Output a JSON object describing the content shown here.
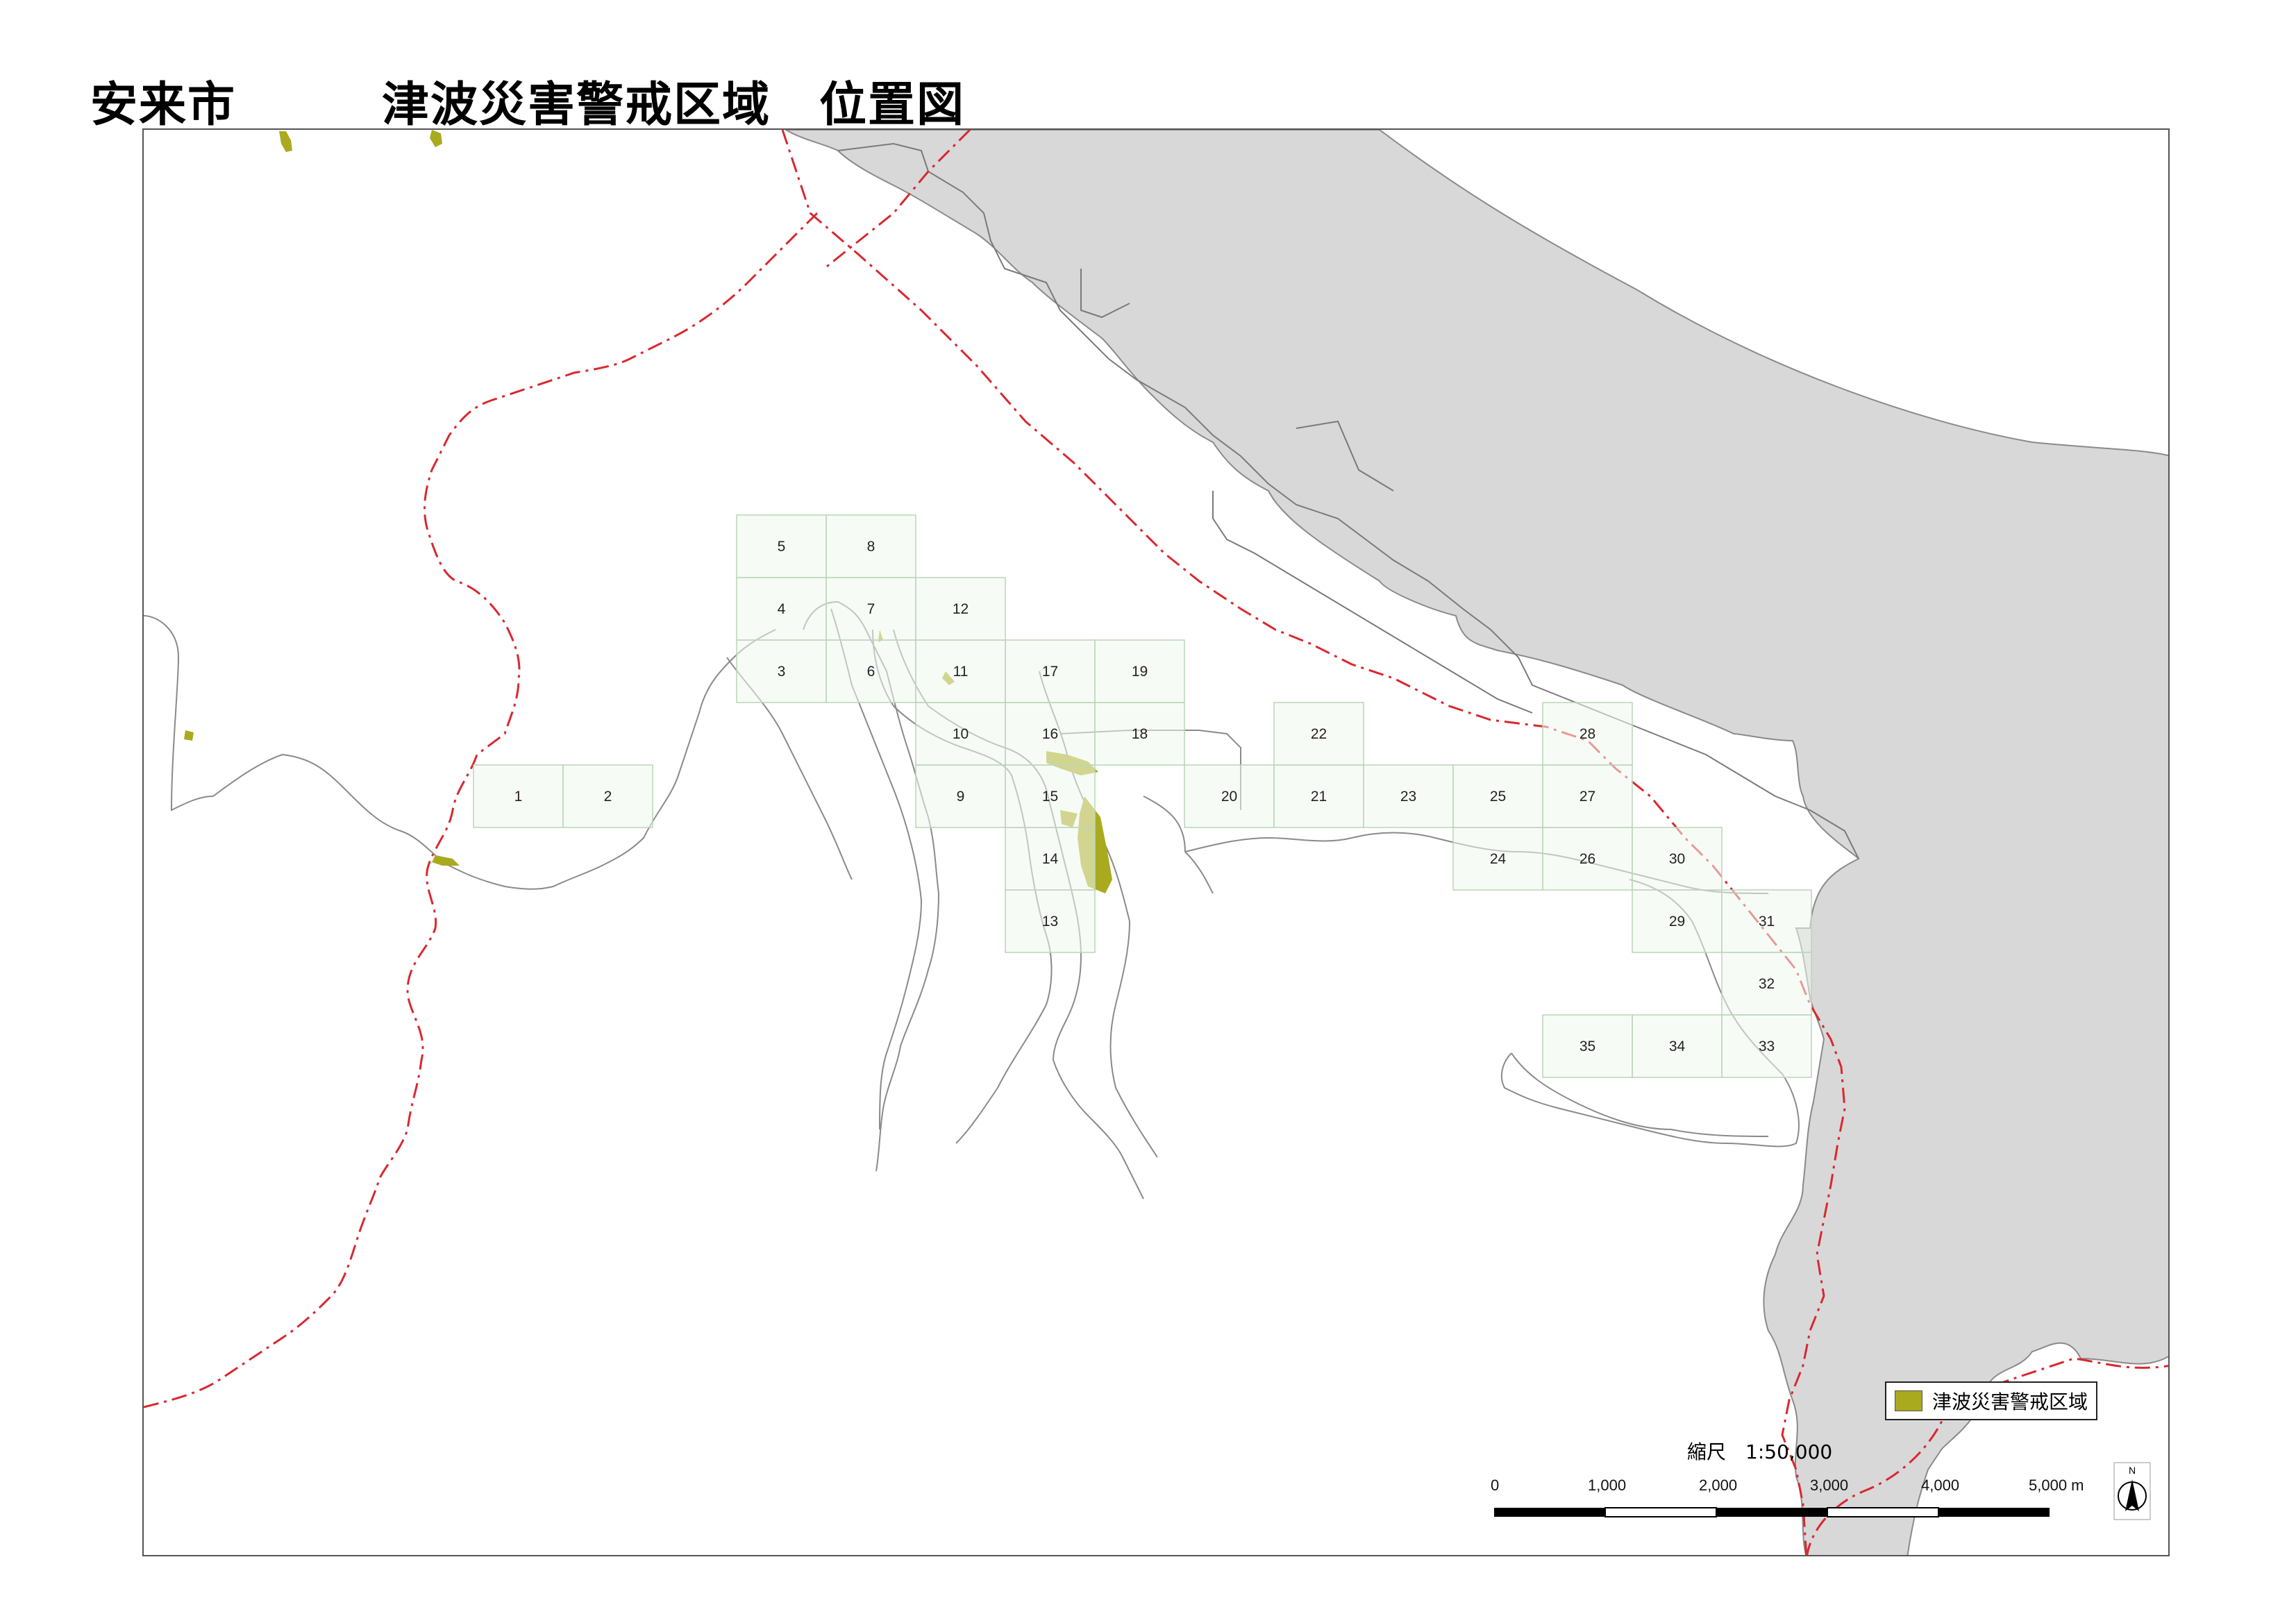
{
  "title": "安来市　　　津波災害警戒区域　位置図",
  "colors": {
    "sea": "#d8d8d8",
    "boundary": "#d9282f",
    "coast": "#8a8a8a",
    "grid_fill": "#f0f8ef",
    "grid_stroke": "#b9d6b6",
    "zone": "#aaaa1e"
  },
  "grid_cells": [
    {
      "label": "1"
    },
    {
      "label": "2"
    },
    {
      "label": "3"
    },
    {
      "label": "4"
    },
    {
      "label": "5"
    },
    {
      "label": "6"
    },
    {
      "label": "7"
    },
    {
      "label": "8"
    },
    {
      "label": "9"
    },
    {
      "label": "10"
    },
    {
      "label": "11"
    },
    {
      "label": "12"
    },
    {
      "label": "13"
    },
    {
      "label": "14"
    },
    {
      "label": "15"
    },
    {
      "label": "16"
    },
    {
      "label": "17"
    },
    {
      "label": "18"
    },
    {
      "label": "19"
    },
    {
      "label": "20"
    },
    {
      "label": "21"
    },
    {
      "label": "22"
    },
    {
      "label": "23"
    },
    {
      "label": "24"
    },
    {
      "label": "25"
    },
    {
      "label": "26"
    },
    {
      "label": "27"
    },
    {
      "label": "28"
    },
    {
      "label": "29"
    },
    {
      "label": "30"
    },
    {
      "label": "31"
    },
    {
      "label": "32"
    },
    {
      "label": "33"
    },
    {
      "label": "34"
    },
    {
      "label": "35"
    }
  ],
  "legend": {
    "label": "津波災害警戒区域"
  },
  "scale": {
    "title": "縮尺　1:50,000",
    "ticks": [
      "0",
      "1,000",
      "2,000",
      "3,000",
      "4,000",
      "5,000 m"
    ]
  },
  "north_arrow": {
    "letter": "N",
    "icon": "north-arrow-icon"
  }
}
